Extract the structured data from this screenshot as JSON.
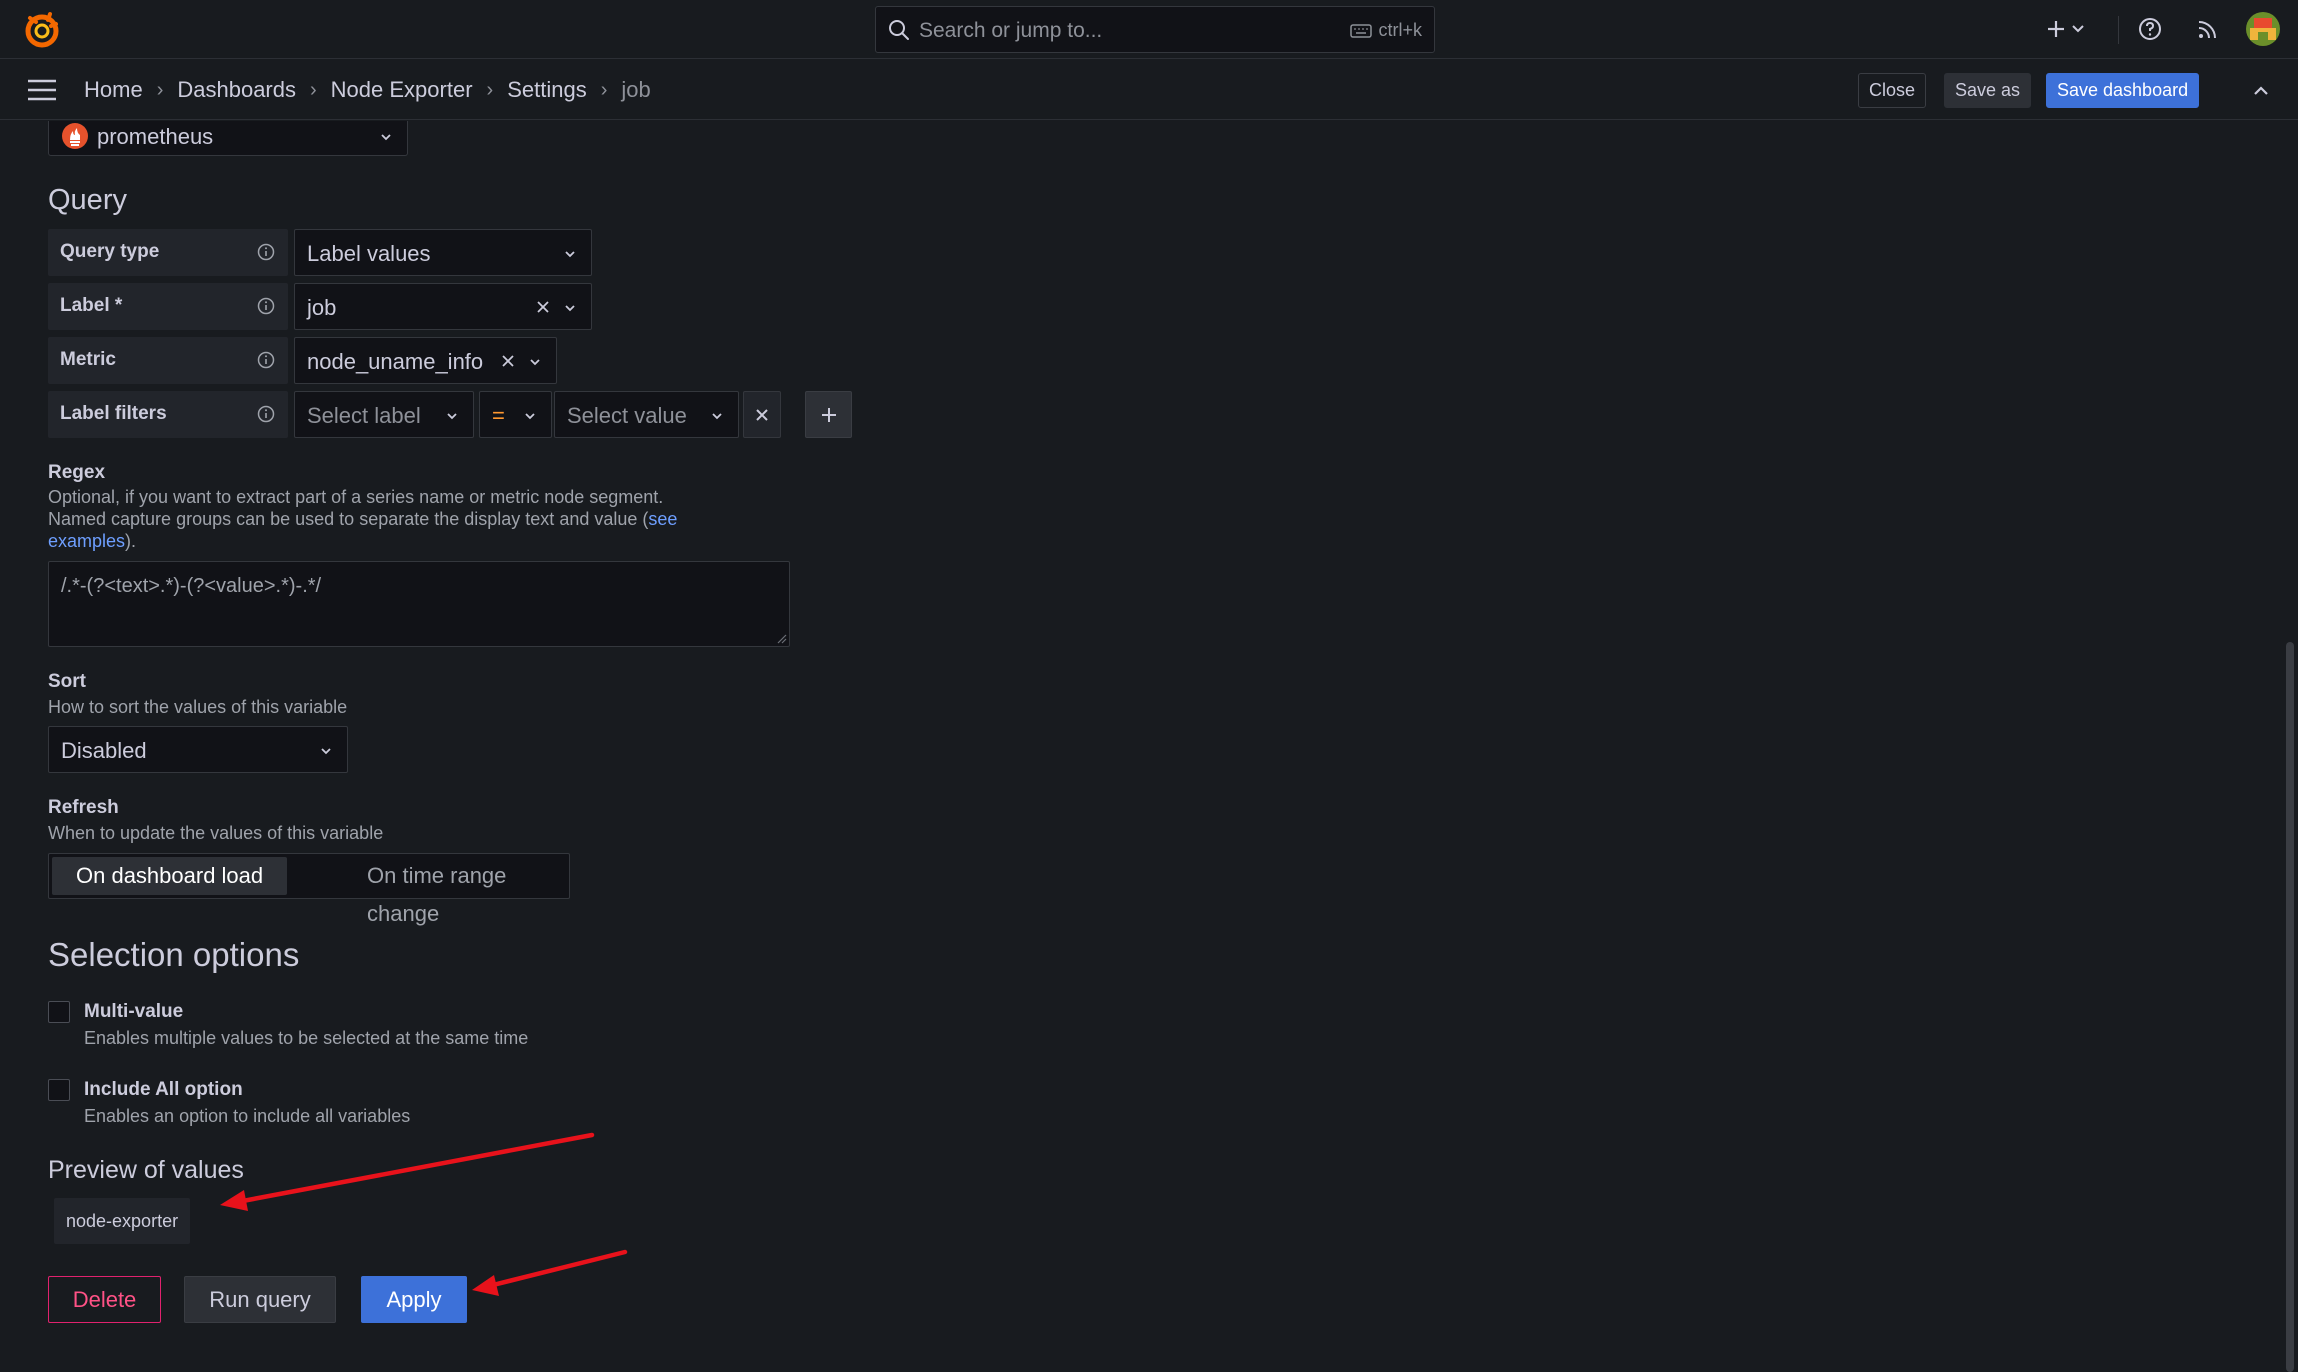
{
  "topbar": {
    "search_placeholder": "Search or jump to...",
    "search_shortcut": "ctrl+k"
  },
  "breadcrumb": {
    "items": [
      "Home",
      "Dashboards",
      "Node Exporter",
      "Settings"
    ],
    "current": "job"
  },
  "actions": {
    "close": "Close",
    "save_as": "Save as",
    "save_dashboard": "Save dashboard"
  },
  "datasource": {
    "name": "prometheus"
  },
  "query": {
    "title": "Query",
    "rows": {
      "query_type": {
        "label": "Query type",
        "value": "Label values"
      },
      "label": {
        "label": "Label *",
        "value": "job"
      },
      "metric": {
        "label": "Metric",
        "value": "node_uname_info"
      },
      "label_filters": {
        "label": "Label filters",
        "select_label": "Select label",
        "operator": "=",
        "select_value": "Select value"
      }
    }
  },
  "regex": {
    "title": "Regex",
    "desc_line1": "Optional, if you want to extract part of a series name or metric node segment.",
    "desc_line2": "Named capture groups can be used to separate the display text and value (",
    "desc_link_a": "see",
    "desc_link_b": "examples",
    "desc_end": ").",
    "value": "/.*-(?<text>.*)-(?<value>.*)-.*/"
  },
  "sort": {
    "title": "Sort",
    "desc": "How to sort the values of this variable",
    "value": "Disabled"
  },
  "refresh": {
    "title": "Refresh",
    "desc": "When to update the values of this variable",
    "options": [
      "On dashboard load",
      "On time range change"
    ],
    "selected": "On dashboard load"
  },
  "selection": {
    "title": "Selection options",
    "multi_value": {
      "label": "Multi-value",
      "desc": "Enables multiple values to be selected at the same time",
      "checked": false
    },
    "include_all": {
      "label": "Include All option",
      "desc": "Enables an option to include all variables",
      "checked": false
    }
  },
  "preview": {
    "title": "Preview of values",
    "values": [
      "node-exporter"
    ]
  },
  "buttons": {
    "delete": "Delete",
    "run_query": "Run query",
    "apply": "Apply"
  },
  "colors": {
    "primary": "#3d71d9",
    "danger": "#e0226e",
    "annotation_arrow": "#e8121b",
    "operator": "#ff9830"
  }
}
